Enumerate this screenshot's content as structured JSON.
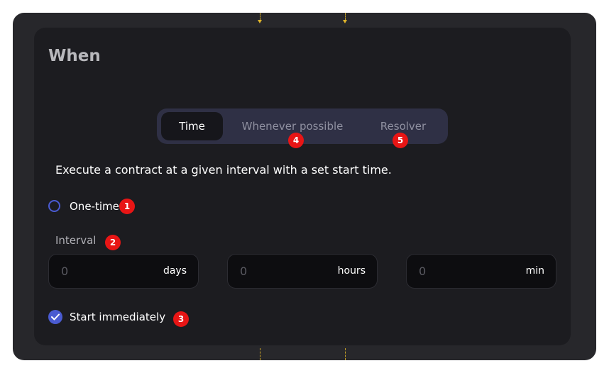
{
  "section": {
    "title": "When"
  },
  "tabs": [
    {
      "label": "Time",
      "active": true
    },
    {
      "label": "Whenever possible",
      "active": false
    },
    {
      "label": "Resolver",
      "active": false
    }
  ],
  "description": "Execute a contract at a given interval with a set start time.",
  "one_time": {
    "label": "One-time",
    "checked": false
  },
  "interval": {
    "label": "Interval",
    "fields": [
      {
        "value": "0",
        "unit": "days"
      },
      {
        "value": "0",
        "unit": "hours"
      },
      {
        "value": "0",
        "unit": "min"
      }
    ]
  },
  "start_immediately": {
    "label": "Start immediately",
    "checked": true
  },
  "annotations": [
    "1",
    "2",
    "3",
    "4",
    "5"
  ],
  "colors": {
    "accent": "#4a5bd1",
    "badge": "#e81515",
    "connector": "#e0b52a"
  }
}
